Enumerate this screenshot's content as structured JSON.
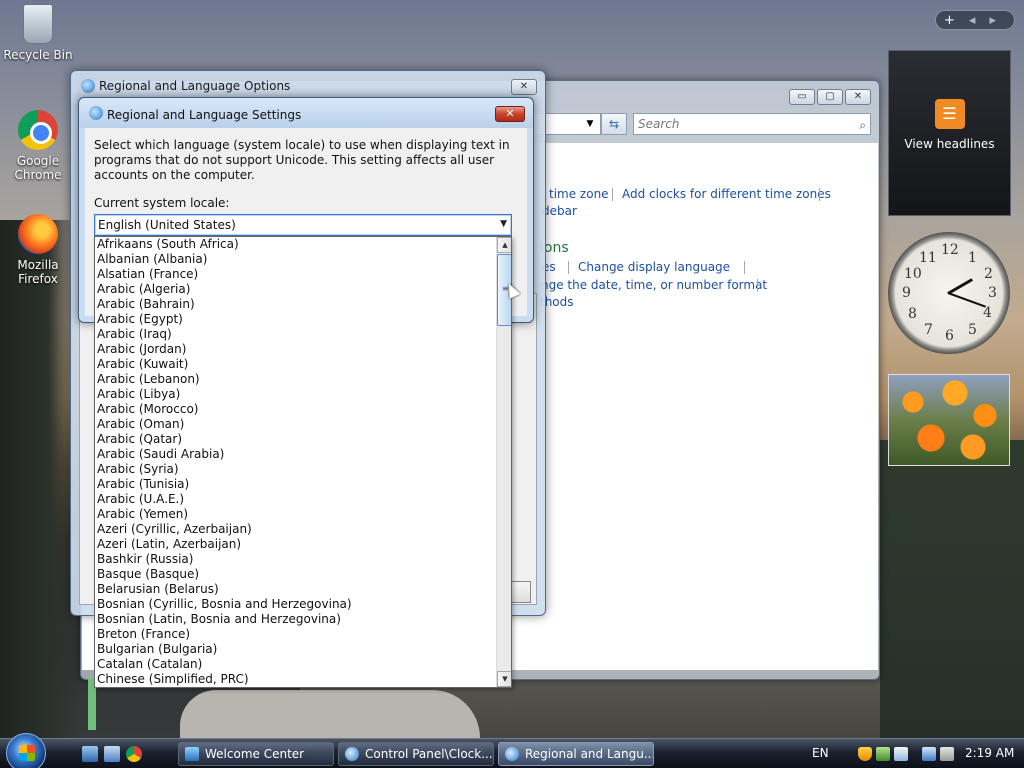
{
  "desktop": {
    "icons": [
      {
        "label": "Recycle Bin"
      },
      {
        "label": "Google Chrome"
      },
      {
        "label": "Mozilla Firefox"
      }
    ]
  },
  "sidebar": {
    "controls": {
      "add": "+",
      "prev": "◂",
      "next": "▸"
    },
    "rss": {
      "icon_text": "☰",
      "label": "View headlines"
    },
    "clock": {
      "numbers": [
        "12",
        "1",
        "2",
        "3",
        "4",
        "5",
        "6",
        "7",
        "8",
        "9",
        "10",
        "11"
      ]
    }
  },
  "control_panel": {
    "buttons": {
      "minimize": "▭",
      "maximize": "▢",
      "close": "✕"
    },
    "search_placeholder": "Search",
    "nav_icon": "⇆",
    "links": {
      "time_zone": "time zone",
      "add_clocks": "Add clocks for different time zones",
      "sidebar": "debar",
      "heading": "ions",
      "es": "es",
      "change_display_language": "Change display language",
      "change_date_format": "nge the date, time, or number format",
      "methods": "thods"
    }
  },
  "regional_options": {
    "title": "Regional and Language Options",
    "close": "✕"
  },
  "regional_settings": {
    "title": "Regional and Language Settings",
    "close": "✕",
    "description": "Select which language (system locale) to use when displaying text in programs that do not support Unicode. This setting affects all user accounts on the computer.",
    "locale_label": "Current system locale:",
    "selected_locale": "English (United States)",
    "locale_options": [
      "Afrikaans (South Africa)",
      "Albanian (Albania)",
      "Alsatian (France)",
      "Arabic (Algeria)",
      "Arabic (Bahrain)",
      "Arabic (Egypt)",
      "Arabic (Iraq)",
      "Arabic (Jordan)",
      "Arabic (Kuwait)",
      "Arabic (Lebanon)",
      "Arabic (Libya)",
      "Arabic (Morocco)",
      "Arabic (Oman)",
      "Arabic (Qatar)",
      "Arabic (Saudi Arabia)",
      "Arabic (Syria)",
      "Arabic (Tunisia)",
      "Arabic (U.A.E.)",
      "Arabic (Yemen)",
      "Azeri (Cyrillic, Azerbaijan)",
      "Azeri (Latin, Azerbaijan)",
      "Bashkir (Russia)",
      "Basque (Basque)",
      "Belarusian (Belarus)",
      "Bosnian (Cyrillic, Bosnia and Herzegovina)",
      "Bosnian (Latin, Bosnia and Herzegovina)",
      "Breton (France)",
      "Bulgarian (Bulgaria)",
      "Catalan (Catalan)",
      "Chinese (Simplified, PRC)"
    ],
    "scroll_up": "▲",
    "scroll_down": "▼",
    "scroll_grip": "≡"
  },
  "taskbar": {
    "buttons": [
      {
        "label": "Welcome Center"
      },
      {
        "label": "Control Panel\\Clock..."
      },
      {
        "label": "Regional and Langu..."
      }
    ],
    "tray": {
      "language": "EN",
      "time": "2:19 AM"
    }
  },
  "colors": {
    "link": "#1e50a2",
    "heading": "#1e7a3a",
    "close_red": "#c9442c",
    "selection_blue": "#3a78c4"
  }
}
